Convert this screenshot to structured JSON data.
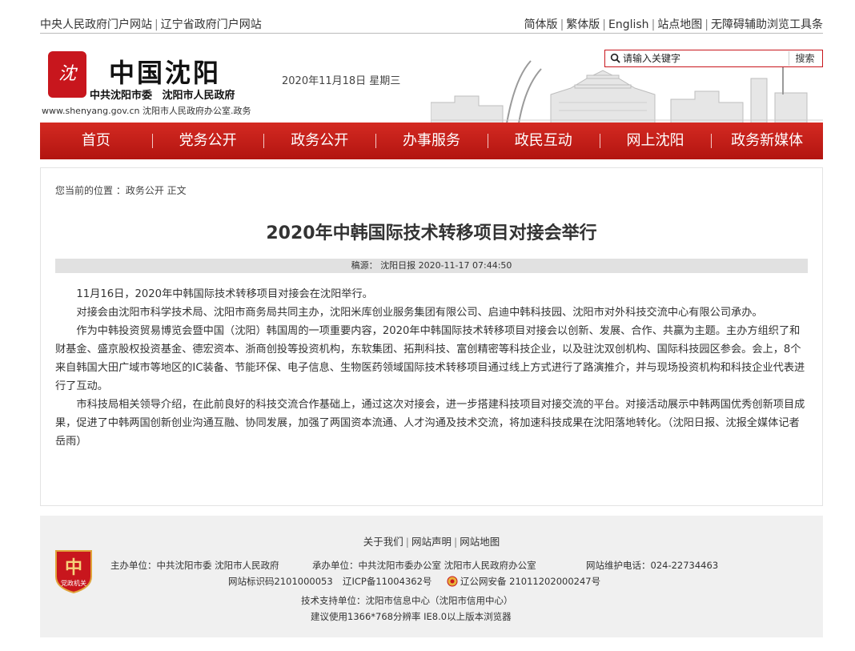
{
  "top_links": {
    "left": [
      "中央人民政府门户网站",
      "辽宁省政府门户网站"
    ],
    "right": [
      "简体版",
      "繁体版",
      "English",
      "站点地图",
      "无障碍辅助浏览工具条"
    ]
  },
  "header": {
    "brand_title": "中国沈阳",
    "brand_sub": "中共沈阳市委 沈阳市人民政府",
    "brand_url": "www.shenyang.gov.cn 沈阳市人民政府办公室.政务",
    "date": "2020年11月18日 星期三",
    "search_placeholder": "请输入关键字",
    "search_button": "搜索"
  },
  "nav": [
    "首页",
    "党务公开",
    "政务公开",
    "办事服务",
    "政民互动",
    "网上沈阳",
    "政务新媒体"
  ],
  "breadcrumb": "您当前的位置 ：政务公开 正文",
  "article": {
    "title": "2020年中韩国际技术转移项目对接会举行",
    "source": "稿源： 沈阳日报 2020-11-17 07:44:50",
    "paragraphs": [
      "11月16日，2020年中韩国际技术转移项目对接会在沈阳举行。",
      "对接会由沈阳市科学技术局、沈阳市商务局共同主办，沈阳米库创业服务集团有限公司、启迪中韩科技园、沈阳市对外科技交流中心有限公司承办。",
      "作为中韩投资贸易博览会暨中国（沈阳）韩国周的一项重要内容，2020年中韩国际技术转移项目对接会以创新、发展、合作、共赢为主题。主办方组织了和财基金、盛京股权投资基金、德宏资本、浙商创投等投资机构，东软集团、拓荆科技、富创精密等科技企业，以及驻沈双创机构、国际科技园区参会。会上，8个来自韩国大田广域市等地区的IC装备、节能环保、电子信息、生物医药领域国际技术转移项目通过线上方式进行了路演推介，并与现场投资机构和科技企业代表进行了互动。",
      "市科技局相关领导介绍，在此前良好的科技交流合作基础上，通过这次对接会，进一步搭建科技项目对接交流的平台。对接活动展示中韩两国优秀创新项目成果，促进了中韩两国创新创业沟通互融、协同发展，加强了两国资本流通、人才沟通及技术交流，将加速科技成果在沈阳落地转化。（沈阳日报、沈报全媒体记者岳雨）"
    ]
  },
  "footer": {
    "links": [
      "关于我们",
      "网站声明",
      "网站地图"
    ],
    "sponsor": "主办单位：中共沈阳市委 沈阳市人民政府",
    "organizer": "承办单位：中共沈阳市委办公室 沈阳市人民政府办公室",
    "hotline": "网站维护电话：024-22734463",
    "site_id": "网站标识码2101000053",
    "icp": "辽ICP备11004362号",
    "police": "辽公网安备 21011202000247号",
    "tech_support": "技术支持单位：沈阳市信息中心（沈阳市信用中心）",
    "browser": "建议使用1366*768分辨率 IE8.0以上版本浏览器",
    "badge_text": "党政机关"
  },
  "colors": {
    "brand_red": "#c8161d",
    "nav_red": "#c41e17",
    "footer_bg": "#f0f0f0"
  }
}
